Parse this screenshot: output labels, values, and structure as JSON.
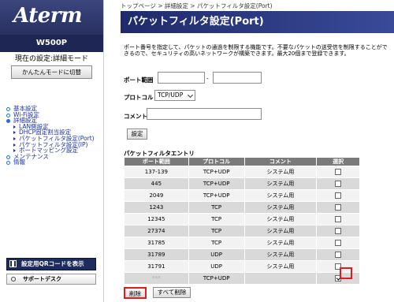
{
  "brand": {
    "logo": "Aterm",
    "model": "W500P"
  },
  "mode": {
    "label": "現在の設定:詳細モード",
    "switch_button": "かんたんモードに切替"
  },
  "nav": {
    "items": [
      {
        "label": "基本設定"
      },
      {
        "label": "Wi-Fi設定"
      },
      {
        "label": "詳細設定"
      },
      {
        "label": "メンテナンス"
      },
      {
        "label": "情報"
      }
    ],
    "sub_items": [
      {
        "label": "LAN側設定"
      },
      {
        "label": "DHCP固定割当設定"
      },
      {
        "label": "パケットフィルタ設定(Port)"
      },
      {
        "label": "パケットフィルタ設定(IP)"
      },
      {
        "label": "ポートマッピング設定"
      }
    ]
  },
  "sidebar_buttons": {
    "qr": "設定用QRコードを表示",
    "support": "サポートデスク"
  },
  "breadcrumb": "トップページ > 詳細設定 > パケットフィルタ設定(Port)",
  "page_title": "パケットフィルタ設定(Port)",
  "description": "ポート番号を指定して、パケットの通過を制限する機能です。不要なパケットの送受信を制限することができるので、セキュリティの高いネットワークが構築できます。最大20個まで登録できます。",
  "form": {
    "port_range_label": "ポート範囲",
    "port_from": "",
    "port_sep": "-",
    "port_to": "",
    "protocol_label": "プロトコル",
    "protocol_value": "TCP/UDP",
    "comment_label": "コメント",
    "comment_value": "",
    "submit": "設定"
  },
  "entries": {
    "title": "パケットフィルタエントリ",
    "columns": [
      "ポート範囲",
      "プロトコル",
      "コメント",
      "選択"
    ],
    "rows": [
      {
        "port": "137-139",
        "protocol": "TCP+UDP",
        "comment": "システム用",
        "checked": false
      },
      {
        "port": "445",
        "protocol": "TCP+UDP",
        "comment": "システム用",
        "checked": false
      },
      {
        "port": "2049",
        "protocol": "TCP+UDP",
        "comment": "システム用",
        "checked": false
      },
      {
        "port": "1243",
        "protocol": "TCP",
        "comment": "システム用",
        "checked": false
      },
      {
        "port": "12345",
        "protocol": "TCP",
        "comment": "システム用",
        "checked": false
      },
      {
        "port": "27374",
        "protocol": "TCP",
        "comment": "システム用",
        "checked": false
      },
      {
        "port": "31785",
        "protocol": "TCP",
        "comment": "システム用",
        "checked": false
      },
      {
        "port": "31789",
        "protocol": "UDP",
        "comment": "システム用",
        "checked": false
      },
      {
        "port": "31791",
        "protocol": "UDP",
        "comment": "システム用",
        "checked": false
      },
      {
        "port": "***",
        "protocol": "TCP+UDP",
        "comment": "",
        "checked": true
      }
    ]
  },
  "actions": {
    "delete": "削除",
    "delete_all": "すべて削除"
  },
  "colors": {
    "header": "#1f2a6a",
    "highlight": "#e01c1c"
  }
}
